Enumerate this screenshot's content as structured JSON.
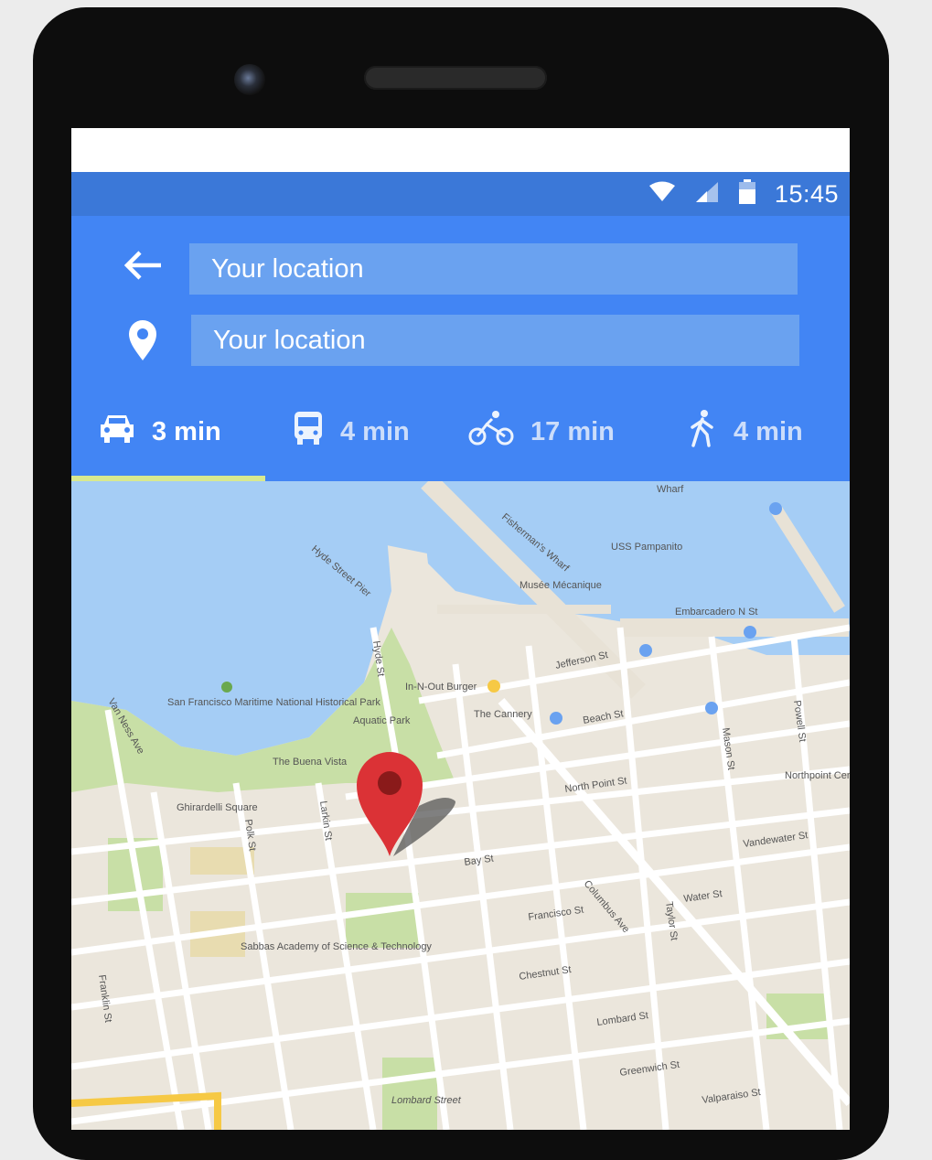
{
  "status_bar": {
    "time": "15:45",
    "icons": [
      "wifi-icon",
      "signal-icon",
      "battery-icon"
    ]
  },
  "directions": {
    "from_value": "Your location",
    "to_value": "Your location",
    "back_icon": "arrow-back-icon",
    "destination_icon": "location-pin-icon"
  },
  "modes": [
    {
      "icon": "car-icon",
      "label": "3 min",
      "selected": true
    },
    {
      "icon": "bus-icon",
      "label": "4 min",
      "selected": false
    },
    {
      "icon": "bicycle-icon",
      "label": "17 min",
      "selected": false
    },
    {
      "icon": "walk-icon",
      "label": "4 min",
      "selected": false
    }
  ],
  "map": {
    "labels": {
      "wharf": "Wharf",
      "fishermans_wharf": "Fisherman's Wharf",
      "uss_pampanito": "USS Pampanito",
      "musee_mecanique": "Musée Mécanique",
      "embarcadero": "Embarcadero N St",
      "hyde_pier": "Hyde Street Pier",
      "maritime": "San Francisco Maritime National Historical Park",
      "in_n_out": "In-N-Out Burger",
      "cannery": "The Cannery",
      "jefferson": "Jefferson St",
      "beach_st": "Beach St",
      "aquatic_park": "Aquatic Park",
      "buena_vista": "The Buena Vista",
      "ghirardelli": "Ghirardelli Square",
      "north_point": "North Point St",
      "northpoint_center": "Northpoint Centre",
      "bay_st": "Bay St",
      "columbus": "Columbus Ave",
      "francisco": "Francisco St",
      "chestnut": "Chestnut St",
      "lombard": "Lombard St",
      "lombard_street": "Lombard Street",
      "greenwich": "Greenwich St",
      "valparaiso": "Valparaiso St",
      "mason": "Mason St",
      "taylor": "Taylor St",
      "powell": "Powell St",
      "hyde": "Hyde St",
      "larkin": "Larkin St",
      "polk": "Polk St",
      "van_ness": "Van Ness Ave",
      "franklin": "Franklin St",
      "sabbas": "Sabbas Academy of Science & Technology",
      "water": "Water St",
      "vandewater": "Vandewater St"
    },
    "colors": {
      "water": "#a5cdf5",
      "park": "#c8dfa6",
      "land": "#ebe6dc",
      "road": "#ffffff",
      "pin": "#db3236",
      "route": "#f6c945"
    }
  }
}
